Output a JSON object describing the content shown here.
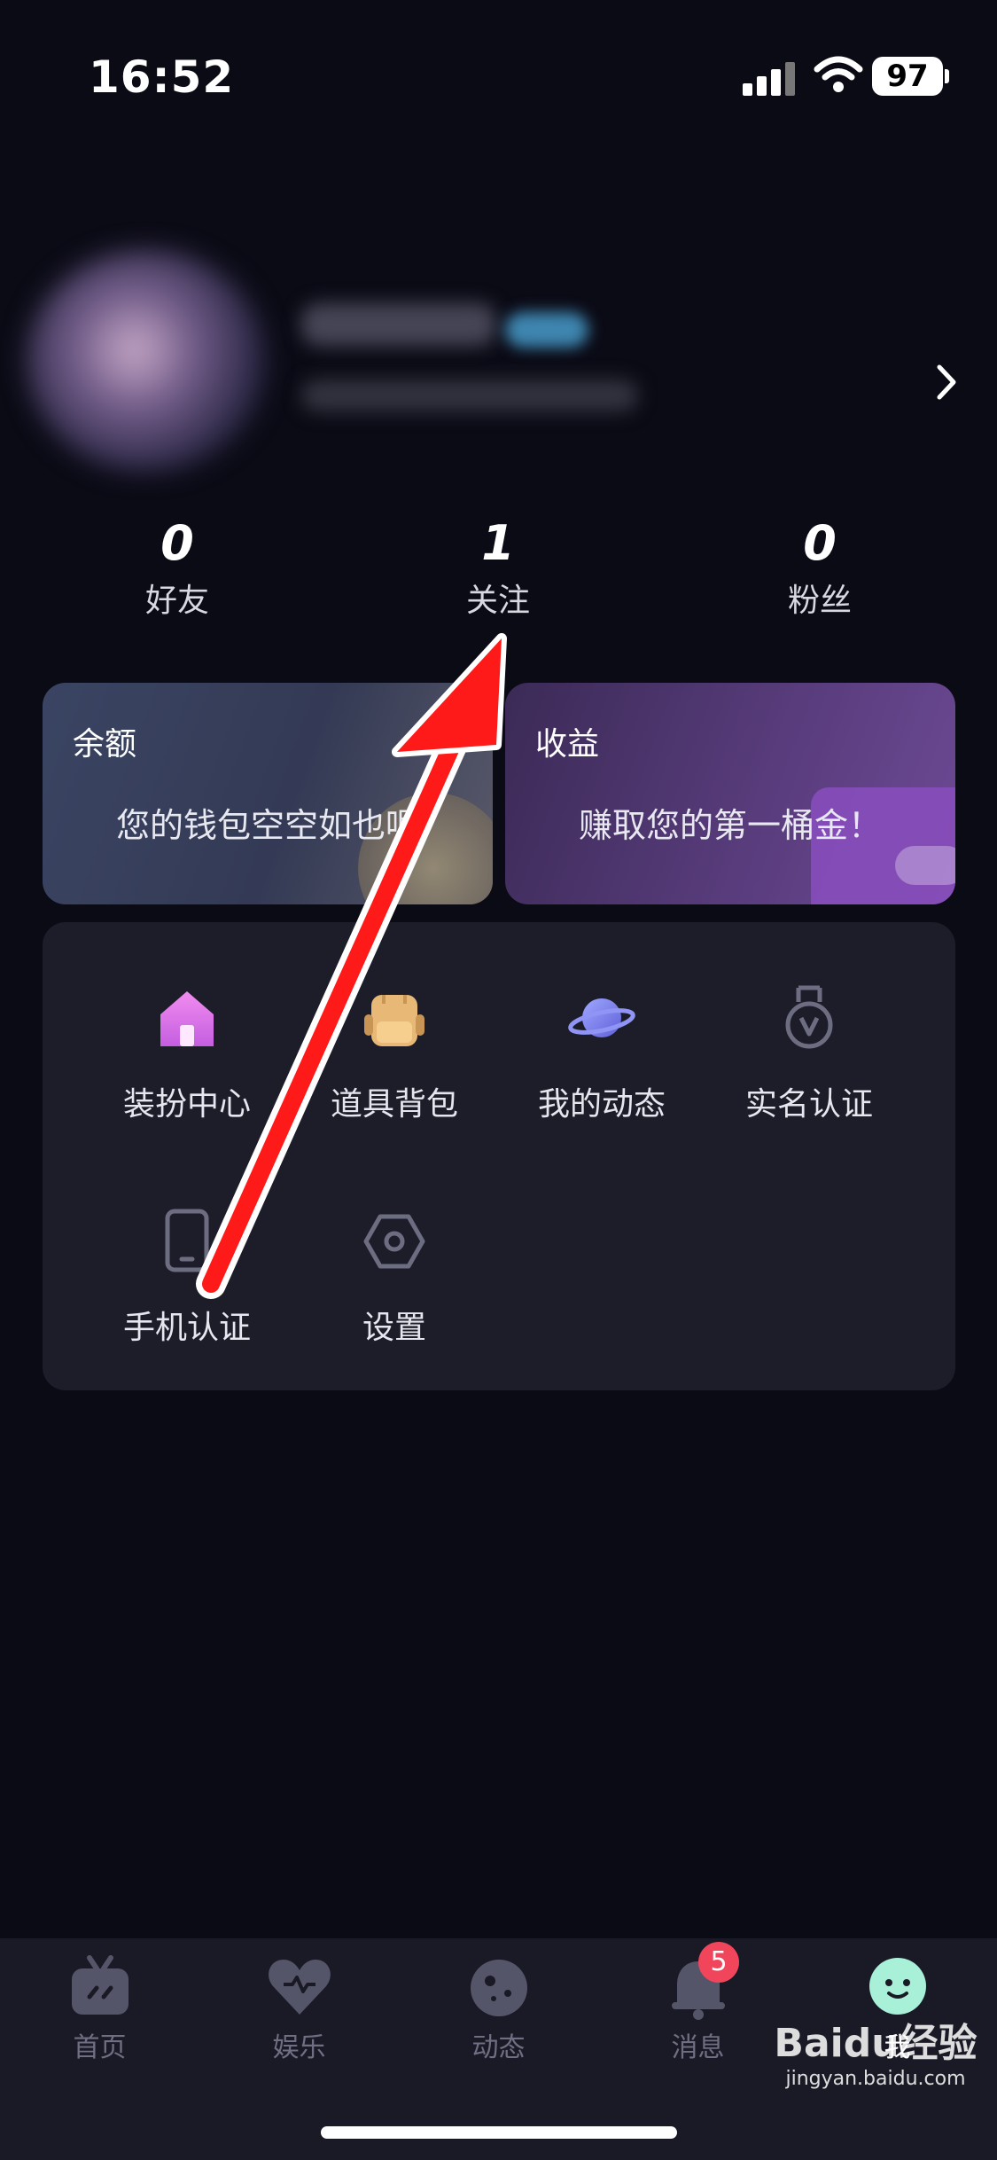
{
  "status_bar": {
    "time": "16:52",
    "battery": "97"
  },
  "stats": [
    {
      "value": "0",
      "label": "好友"
    },
    {
      "value": "1",
      "label": "关注"
    },
    {
      "value": "0",
      "label": "粉丝"
    }
  ],
  "cards": {
    "balance": {
      "title": "余额",
      "text": "您的钱包空空如也呢"
    },
    "income": {
      "title": "收益",
      "text": "赚取您的第一桶金！"
    }
  },
  "grid": [
    {
      "label": "装扮中心",
      "icon": "house-icon"
    },
    {
      "label": "道具背包",
      "icon": "backpack-icon"
    },
    {
      "label": "我的动态",
      "icon": "planet-icon"
    },
    {
      "label": "实名认证",
      "icon": "medal-icon"
    },
    {
      "label": "手机认证",
      "icon": "phone-icon"
    },
    {
      "label": "设置",
      "icon": "settings-icon"
    }
  ],
  "tabs": [
    {
      "label": "首页",
      "icon": "tv-icon"
    },
    {
      "label": "娱乐",
      "icon": "heart-icon"
    },
    {
      "label": "动态",
      "icon": "planet-icon"
    },
    {
      "label": "消息",
      "icon": "bell-icon"
    },
    {
      "label": "我",
      "icon": "face-icon"
    }
  ],
  "messages_badge": "5",
  "watermark": {
    "brand": "Baidu经验",
    "url": "jingyan.baidu.com"
  },
  "colors": {
    "background": "#0b0b16",
    "accent_green": "#a8f0d8",
    "badge": "#f0455b",
    "arrow": "#ff1a1a"
  }
}
